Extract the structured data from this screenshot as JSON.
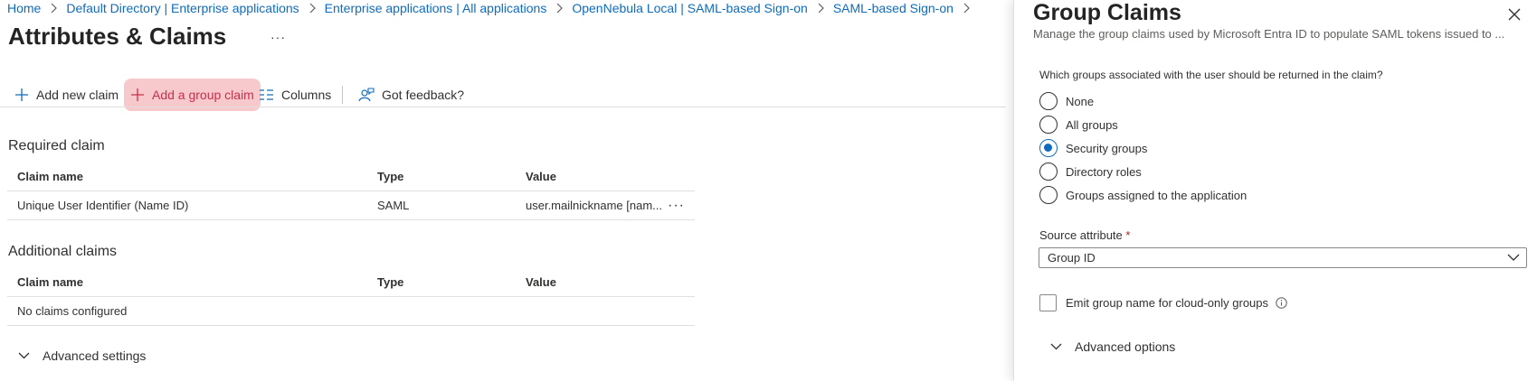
{
  "breadcrumb": {
    "items": [
      "Home",
      "Default Directory | Enterprise applications",
      "Enterprise applications | All applications",
      "OpenNebula Local | SAML-based Sign-on",
      "SAML-based Sign-on"
    ]
  },
  "page": {
    "title": "Attributes & Claims",
    "more_glyph": "···"
  },
  "toolbar": {
    "add_new_claim": "Add new claim",
    "add_group_claim": "Add a group claim",
    "columns": "Columns",
    "got_feedback": "Got feedback?",
    "highlight_color": "#f8c9cc"
  },
  "required_claim": {
    "title": "Required claim",
    "columns": [
      "Claim name",
      "Type",
      "Value"
    ],
    "rows": [
      {
        "name": "Unique User Identifier (Name ID)",
        "type": "SAML",
        "value": "user.mailnickname [nam...",
        "more": "···"
      }
    ]
  },
  "additional_claims": {
    "title": "Additional claims",
    "columns": [
      "Claim name",
      "Type",
      "Value"
    ],
    "empty_text": "No claims configured"
  },
  "advanced_settings": {
    "label": "Advanced settings"
  },
  "panel": {
    "title": "Group Claims",
    "subtitle": "Manage the group claims used by Microsoft Entra ID to populate SAML tokens issued to ...",
    "question": "Which groups associated with the user should be returned in the claim?",
    "options": [
      "None",
      "All groups",
      "Security groups",
      "Directory roles",
      "Groups assigned to the application"
    ],
    "selected_option": "Security groups",
    "source_attribute": {
      "label": "Source attribute",
      "required_mark": "*",
      "value": "Group ID"
    },
    "emit_checkbox": {
      "label": "Emit group name for cloud-only groups",
      "checked": false
    },
    "advanced_options": {
      "label": "Advanced options"
    },
    "accent_color": "#0f6cbd"
  },
  "icons": {
    "breadcrumb_separator": "chevron-right-icon",
    "add_claim": "plus-icon",
    "columns": "columns-icon",
    "feedback": "feedback-person-icon",
    "expand": "chevron-down-icon",
    "close": "close-icon",
    "info": "info-icon"
  }
}
